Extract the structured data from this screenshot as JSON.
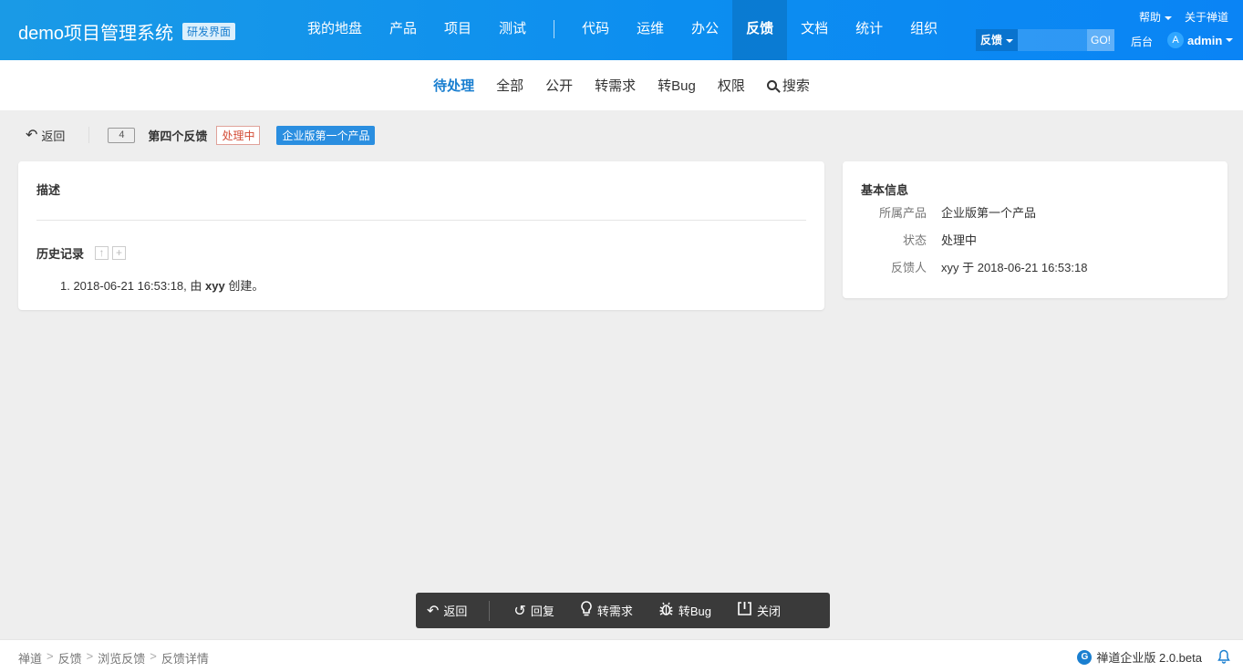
{
  "header": {
    "brand": "demo项目管理系统",
    "badge": "研发界面",
    "nav": [
      "我的地盘",
      "产品",
      "项目",
      "测试",
      "代码",
      "运维",
      "办公",
      "反馈",
      "文档",
      "统计",
      "组织"
    ],
    "active_nav": "反馈",
    "help": "帮助",
    "about": "关于禅道",
    "search_type": "反馈",
    "search_value": "",
    "search_go": "GO!",
    "admin_link": "后台",
    "avatar_letter": "A",
    "user": "admin"
  },
  "subnav": {
    "items": [
      "待处理",
      "全部",
      "公开",
      "转需求",
      "转Bug",
      "权限",
      "搜索"
    ],
    "active": "待处理"
  },
  "title_bar": {
    "back": "返回",
    "id": "4",
    "title": "第四个反馈",
    "status": "处理中",
    "product": "企业版第一个产品"
  },
  "main_panel": {
    "desc_title": "描述",
    "history_title": "历史记录",
    "history": [
      {
        "prefix": "1. 2018-06-21 16:53:18, 由 ",
        "user": "xyy",
        "suffix": " 创建。"
      }
    ]
  },
  "side_panel": {
    "title": "基本信息",
    "rows": [
      {
        "label": "所属产品",
        "value": "企业版第一个产品"
      },
      {
        "label": "状态",
        "value": "处理中"
      },
      {
        "label": "反馈人",
        "value": "xyy 于 2018-06-21 16:53:18"
      }
    ]
  },
  "actions": {
    "back": "返回",
    "reply": "回复",
    "to_story": "转需求",
    "to_bug": "转Bug",
    "close": "关闭"
  },
  "footer": {
    "crumbs": [
      "禅道",
      "反馈",
      "浏览反馈",
      "反馈详情"
    ],
    "version": "禅道企业版 2.0.beta"
  },
  "colors": {
    "header": "#0c8ef0",
    "accent": "#1a7fd0",
    "status_red": "#d34b35",
    "product_tag": "#2a8ee0",
    "action_bar": "#3a3a3a"
  }
}
